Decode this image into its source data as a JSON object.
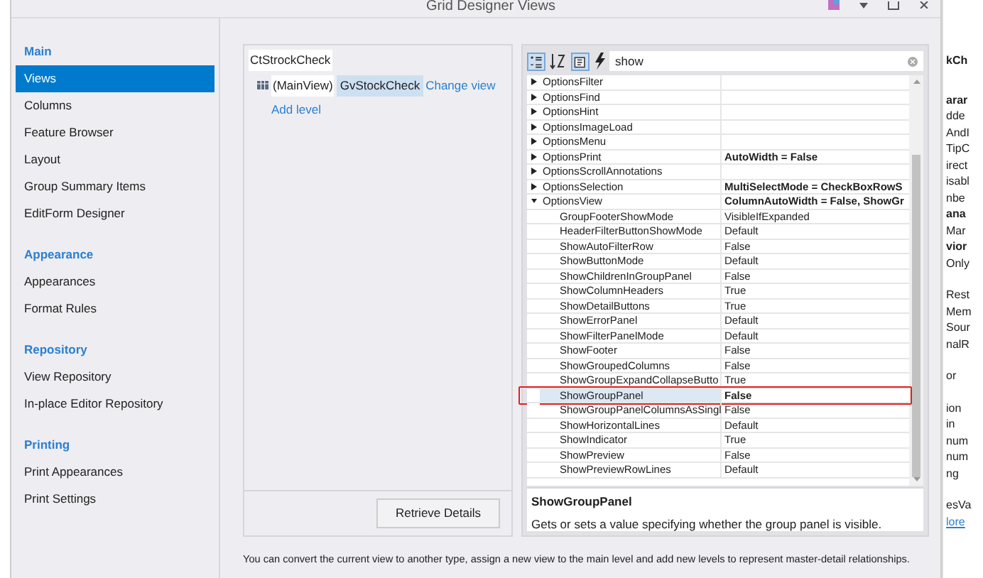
{
  "window": {
    "title": "Grid Designer Views"
  },
  "nav": {
    "sections": [
      {
        "title": "Main",
        "items": [
          {
            "label": "Views",
            "selected": true
          },
          {
            "label": "Columns",
            "selected": false
          },
          {
            "label": "Feature Browser",
            "selected": false
          },
          {
            "label": "Layout",
            "selected": false
          },
          {
            "label": "Group Summary Items",
            "selected": false
          },
          {
            "label": "EditForm Designer",
            "selected": false
          }
        ]
      },
      {
        "title": "Appearance",
        "items": [
          {
            "label": "Appearances",
            "selected": false
          },
          {
            "label": "Format Rules",
            "selected": false
          }
        ]
      },
      {
        "title": "Repository",
        "items": [
          {
            "label": "View Repository",
            "selected": false
          },
          {
            "label": "In-place Editor Repository",
            "selected": false
          }
        ]
      },
      {
        "title": "Printing",
        "items": [
          {
            "label": "Print Appearances",
            "selected": false
          },
          {
            "label": "Print Settings",
            "selected": false
          }
        ]
      }
    ]
  },
  "levels": {
    "root": "CtStrockCheck",
    "level_label": "(MainView)",
    "view_name": "GvStockCheck",
    "change_link": "Change view",
    "add_link": "Add level",
    "button": "Retrieve Details"
  },
  "property_grid": {
    "search": {
      "value": "show"
    },
    "rows": [
      {
        "name": "OptionsFilter",
        "kind": "group",
        "expanded": false,
        "highlighted": false
      },
      {
        "name": "OptionsFind",
        "kind": "group",
        "expanded": false,
        "highlighted": false
      },
      {
        "name": "OptionsHint",
        "kind": "group",
        "expanded": false,
        "highlighted": false
      },
      {
        "name": "OptionsImageLoad",
        "kind": "group",
        "expanded": false,
        "highlighted": false
      },
      {
        "name": "OptionsMenu",
        "kind": "group",
        "expanded": false,
        "highlighted": false
      },
      {
        "name": "OptionsPrint",
        "value": "AutoWidth = False",
        "kind": "group",
        "expanded": false,
        "modified": true,
        "highlighted": false
      },
      {
        "name": "OptionsScrollAnnotations",
        "kind": "group",
        "expanded": false,
        "highlighted": false
      },
      {
        "name": "OptionsSelection",
        "value": "MultiSelectMode = CheckBoxRowS",
        "kind": "group",
        "expanded": false,
        "modified": true,
        "highlighted": false
      },
      {
        "name": "OptionsView",
        "value": "ColumnAutoWidth = False, ShowGr",
        "kind": "group",
        "expanded": true,
        "modified": true,
        "highlighted": false
      },
      {
        "name": "GroupFooterShowMode",
        "value": "VisibleIfExpanded",
        "kind": "child",
        "modified": false,
        "highlighted": false
      },
      {
        "name": "HeaderFilterButtonShowMode",
        "value": "Default",
        "kind": "child",
        "modified": false,
        "highlighted": false
      },
      {
        "name": "ShowAutoFilterRow",
        "value": "False",
        "kind": "child",
        "modified": false,
        "highlighted": false
      },
      {
        "name": "ShowButtonMode",
        "value": "Default",
        "kind": "child",
        "modified": false,
        "highlighted": false
      },
      {
        "name": "ShowChildrenInGroupPanel",
        "value": "False",
        "kind": "child",
        "modified": false,
        "highlighted": false
      },
      {
        "name": "ShowColumnHeaders",
        "value": "True",
        "kind": "child",
        "modified": false,
        "highlighted": false
      },
      {
        "name": "ShowDetailButtons",
        "value": "True",
        "kind": "child",
        "modified": false,
        "highlighted": false
      },
      {
        "name": "ShowErrorPanel",
        "value": "Default",
        "kind": "child",
        "modified": false,
        "highlighted": false
      },
      {
        "name": "ShowFilterPanelMode",
        "value": "Default",
        "kind": "child",
        "modified": false,
        "highlighted": false
      },
      {
        "name": "ShowFooter",
        "value": "False",
        "kind": "child",
        "modified": false,
        "highlighted": false
      },
      {
        "name": "ShowGroupedColumns",
        "value": "False",
        "kind": "child",
        "modified": false,
        "highlighted": false
      },
      {
        "name": "ShowGroupExpandCollapseButto",
        "value": "True",
        "kind": "child",
        "modified": false,
        "highlighted": false
      },
      {
        "name": "ShowGroupPanel",
        "value": "False",
        "kind": "child",
        "modified": true,
        "highlighted": true
      },
      {
        "name": "ShowGroupPanelColumnsAsSingl",
        "value": "False",
        "kind": "child",
        "modified": false,
        "highlighted": false
      },
      {
        "name": "ShowHorizontalLines",
        "value": "Default",
        "kind": "child",
        "modified": false,
        "highlighted": false
      },
      {
        "name": "ShowIndicator",
        "value": "True",
        "kind": "child",
        "modified": false,
        "highlighted": false
      },
      {
        "name": "ShowPreview",
        "value": "False",
        "kind": "child",
        "modified": false,
        "highlighted": false
      },
      {
        "name": "ShowPreviewRowLines",
        "value": "Default",
        "kind": "child",
        "modified": false,
        "highlighted": false
      }
    ],
    "description": {
      "title": "ShowGroupPanel",
      "text": "Gets or sets a value specifying whether the group panel is visible."
    }
  },
  "footer_text": "You can convert the current view to another type, assign a new view to the main level and add new levels to represent master-detail relationships.",
  "side_panel": {
    "sections": [
      [
        {
          "text": "kCh",
          "kind": "heading"
        }
      ],
      [
        {
          "text": "arar",
          "kind": "heading"
        },
        {
          "text": "dde",
          "kind": "item"
        },
        {
          "text": "AndI",
          "kind": "item"
        },
        {
          "text": "TipC",
          "kind": "item"
        },
        {
          "text": "irect",
          "kind": "item"
        },
        {
          "text": "isabl",
          "kind": "item"
        },
        {
          "text": "nbe",
          "kind": "item"
        },
        {
          "text": "ana",
          "kind": "heading"
        },
        {
          "text": "Mar",
          "kind": "item"
        },
        {
          "text": "vior",
          "kind": "heading"
        },
        {
          "text": "Only",
          "kind": "item"
        }
      ],
      [
        {
          "text": "Rest",
          "kind": "item"
        },
        {
          "text": "Mem",
          "kind": "item"
        },
        {
          "text": "Sour",
          "kind": "item"
        },
        {
          "text": "nalR",
          "kind": "item"
        }
      ],
      [
        {
          "text": "or",
          "kind": "item"
        }
      ],
      [
        {
          "text": "ion",
          "kind": "item"
        },
        {
          "text": "in",
          "kind": "item"
        },
        {
          "text": "num",
          "kind": "item"
        },
        {
          "text": "num",
          "kind": "item"
        },
        {
          "text": "ng",
          "kind": "item"
        }
      ],
      [
        {
          "text": "esVa",
          "kind": "item"
        },
        {
          "text": "lore",
          "kind": "link"
        }
      ]
    ]
  }
}
